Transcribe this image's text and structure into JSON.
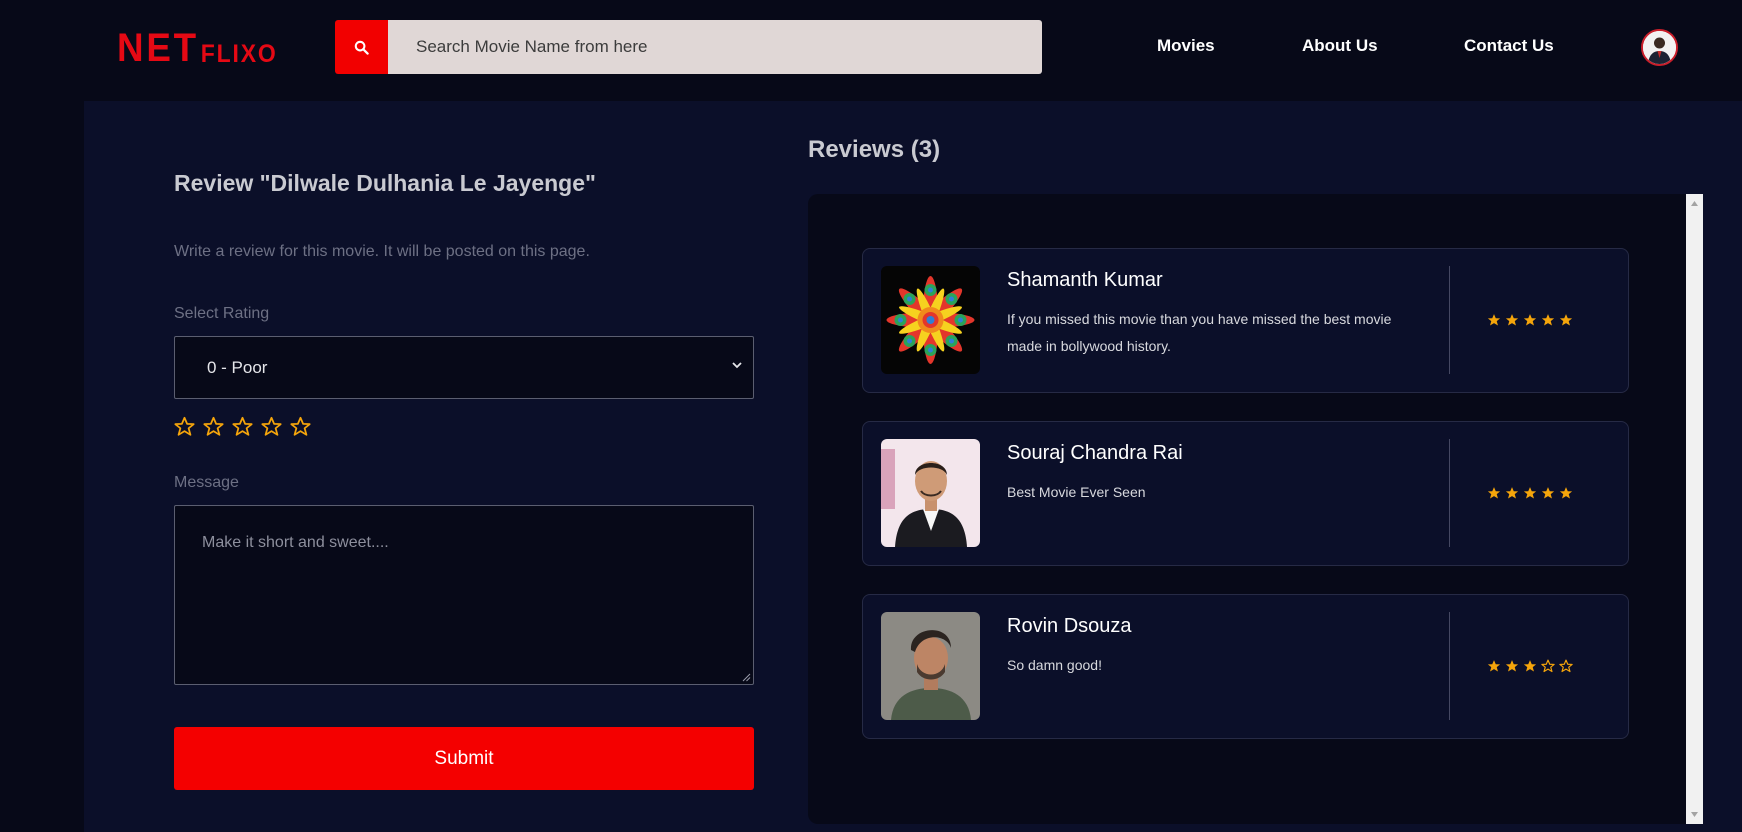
{
  "header": {
    "logo_big": "NET",
    "logo_small": "FLIXO",
    "search_placeholder": "Search Movie Name from here",
    "nav": [
      "Movies",
      "About Us",
      "Contact Us"
    ]
  },
  "form": {
    "title": "Review \"Dilwale Dulhania Le Jayenge\"",
    "subtitle": "Write a review for this movie. It will be posted on this page.",
    "rating_label": "Select Rating",
    "rating_value": "0 - Poor",
    "stars": 0,
    "message_label": "Message",
    "message_placeholder": "Make it short and sweet....",
    "submit_label": "Submit"
  },
  "reviews": {
    "title": "Reviews (3)",
    "items": [
      {
        "name": "Shamanth Kumar",
        "message": "If you missed this movie than you have missed the best movie made in bollywood history.",
        "rating": 5
      },
      {
        "name": "Souraj Chandra Rai",
        "message": "Best Movie Ever Seen",
        "rating": 5
      },
      {
        "name": "Rovin Dsouza",
        "message": "So damn good!",
        "rating": 3
      }
    ]
  },
  "colors": {
    "brand": "#e50914",
    "accent": "#f40000",
    "star": "#f5a50b",
    "background": "#070918",
    "panel": "#0b0f29"
  },
  "icons": {
    "search": "search-icon",
    "chevron": "chevron-down-icon",
    "star": "star-icon",
    "resize": "resize-grip-icon"
  }
}
